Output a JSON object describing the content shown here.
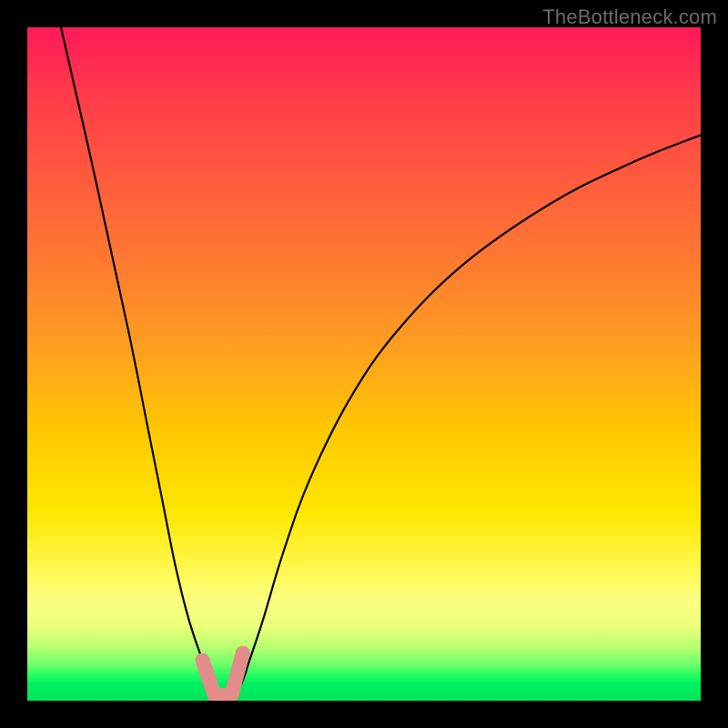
{
  "watermark": "TheBottleneck.com",
  "chart_data": {
    "type": "line",
    "title": "",
    "xlabel": "",
    "ylabel": "",
    "xlim": [
      0,
      100
    ],
    "ylim": [
      0,
      100
    ],
    "grid": false,
    "series": [
      {
        "name": "bottleneck-curve",
        "x": [
          5,
          10,
          15,
          18,
          20,
          22,
          24,
          26,
          27,
          28,
          29,
          30,
          31,
          32,
          33,
          35,
          38,
          42,
          48,
          55,
          65,
          78,
          90,
          100
        ],
        "values": [
          100,
          78,
          55,
          40,
          30,
          20,
          12,
          6,
          3,
          1,
          0,
          0,
          1,
          3,
          6,
          12,
          22,
          33,
          45,
          55,
          65,
          74,
          80,
          84
        ]
      }
    ],
    "annotations": [
      {
        "name": "valley-marker",
        "shape": "L",
        "color": "#e38d8a",
        "x_range": [
          26,
          32
        ],
        "y_range": [
          0,
          6
        ]
      }
    ]
  }
}
